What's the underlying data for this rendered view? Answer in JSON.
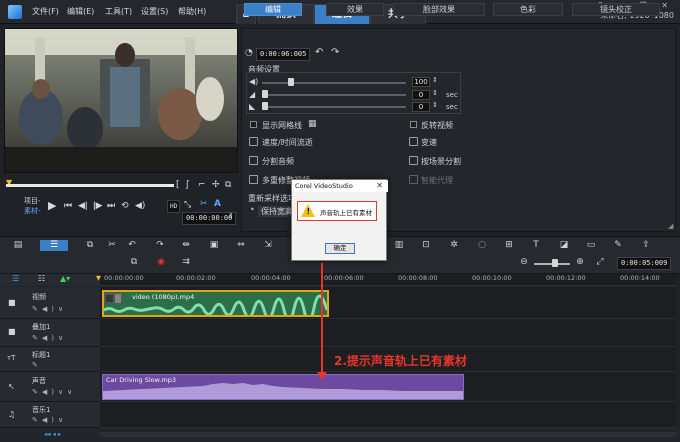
{
  "menu": [
    "文件(F)",
    "编辑(E)",
    "工具(T)",
    "设置(S)",
    "帮助(H)"
  ],
  "tabs": {
    "home_icon": "home-icon",
    "capture": "捕获",
    "edit": "编辑",
    "share": "共享"
  },
  "project_info": "未命名, 1920*1080",
  "player": {
    "project_label": "项目-",
    "clip_label": "素材-",
    "timecode": "00:00:00:00",
    "hd_badge": "HD"
  },
  "options": {
    "tabs": [
      "编辑",
      "效果",
      "脸部效果",
      "色彩",
      "镜头校正"
    ],
    "duration": "0:00:06:005",
    "audio_section": "音频设置",
    "volume": "100",
    "fade_in": "0",
    "fade_out": "0",
    "unit_sec": "sec",
    "items": {
      "show_grid": "显示网格线",
      "reverse": "反转视频",
      "speed_time": "速度/时间流逝",
      "variable_speed": "变速",
      "split_audio": "分割音频",
      "split_by_scene": "按场景分割",
      "multi_trim": "多重修整视频",
      "smart_proxy": "智能代理",
      "resample_option": "重新采样选项",
      "keep_aspect": "保持宽高比"
    }
  },
  "timeline": {
    "ruler": [
      "00:00:02:00",
      "00:00:04:00",
      "00:00:06:00",
      "00:00:08:00",
      "00:00:10:00",
      "00:00:12:00",
      "00:00:14:00"
    ],
    "zoom_timecode": "0:00:05:009",
    "ruler_start": "00:00:00:00",
    "tracks": [
      {
        "name": "视频"
      },
      {
        "name": "叠加1"
      },
      {
        "name": "标题1"
      },
      {
        "name": "声音"
      },
      {
        "name": "音乐1"
      }
    ],
    "video_clip": "video (1080p).mp4",
    "audio_clip": "Car Driving Slow.mp3"
  },
  "dialog": {
    "title": "Corel VideoStudio",
    "message": "声音轨上已有素材",
    "ok": "确定"
  },
  "annotation": "2.提示声音轨上已有素材",
  "colors": {
    "accent": "#3b7fc7",
    "highlight": "#e8352a",
    "video_clip": "#2c6e4a",
    "audio_clip": "#6c4aa0"
  }
}
